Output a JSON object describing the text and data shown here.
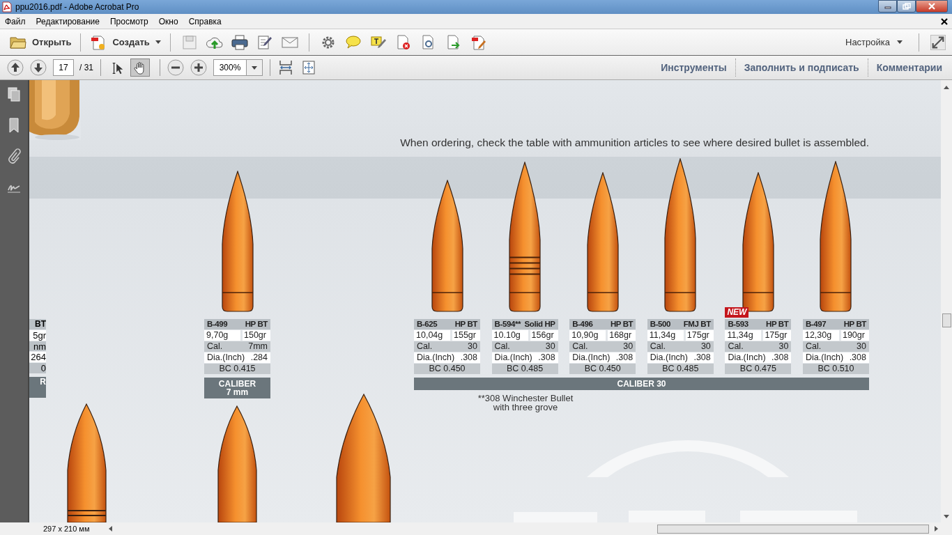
{
  "window": {
    "title": "ppu2016.pdf - Adobe Acrobat Pro"
  },
  "menu": [
    "Файл",
    "Редактирование",
    "Просмотр",
    "Окно",
    "Справка"
  ],
  "toolbar": {
    "open": "Открыть",
    "create": "Создать",
    "customize": "Настройка"
  },
  "navigation": {
    "page": "17",
    "total": "/ 31",
    "zoom": "300%",
    "tools": [
      {
        "kind": "select",
        "selected": false
      },
      {
        "kind": "hand",
        "selected": true
      }
    ]
  },
  "panels": [
    "Инструменты",
    "Заполнить и подписать",
    "Комментарии"
  ],
  "document": {
    "note": "When ordering, check the table with ammunition articles to see where desired bullet is assembled.",
    "cut_card": {
      "rows": [
        "BT",
        "5gr",
        "nm",
        "264",
        "0"
      ],
      "caliber": "R"
    },
    "groups": [
      {
        "caliber": [
          "CALIBER",
          "7 mm"
        ],
        "items": [
          {
            "code": "B-499",
            "type": "HP BT",
            "grams": "9,70g",
            "grains": "150gr",
            "cal_label": "Cal.",
            "cal": "7mm",
            "dia_label": "Dia.(Inch)",
            "dia": ".284",
            "bc": "BC 0.415",
            "grooved": false
          }
        ]
      },
      {
        "caliber": [
          "CALIBER 30"
        ],
        "footnote": [
          "**308 Winchester Bullet",
          "with three grove"
        ],
        "items": [
          {
            "code": "B-625",
            "type": "HP BT",
            "grams": "10,04g",
            "grains": "155gr",
            "cal_label": "Cal.",
            "cal": "30",
            "dia_label": "Dia.(Inch)",
            "dia": ".308",
            "bc": "BC 0.450",
            "grooved": false
          },
          {
            "code": "B-594**",
            "type": "Solid HP",
            "grams": "10.10g",
            "grains": "156gr",
            "cal_label": "Cal.",
            "cal": "30",
            "dia_label": "Dia.(Inch)",
            "dia": ".308",
            "bc": "BC 0.485",
            "grooved": true
          },
          {
            "code": "B-496",
            "type": "HP BT",
            "grams": "10,90g",
            "grains": "168gr",
            "cal_label": "Cal.",
            "cal": "30",
            "dia_label": "Dia.(Inch)",
            "dia": ".308",
            "bc": "BC 0.450",
            "grooved": false
          },
          {
            "code": "B-500",
            "type": "FMJ BT",
            "grams": "11,34g",
            "grains": "175gr",
            "cal_label": "Cal.",
            "cal": "30",
            "dia_label": "Dia.(Inch)",
            "dia": ".308",
            "bc": "BC 0.485",
            "grooved": false
          },
          {
            "code": "B-593",
            "type": "HP BT",
            "grams": "11,34g",
            "grains": "175gr",
            "cal_label": "Cal.",
            "cal": "30",
            "dia_label": "Dia.(Inch)",
            "dia": ".308",
            "bc": "BC 0.475",
            "grooved": false,
            "badge": "NEW"
          },
          {
            "code": "B-497",
            "type": "HP BT",
            "grams": "12,30g",
            "grains": "190gr",
            "cal_label": "Cal.",
            "cal": "30",
            "dia_label": "Dia.(Inch)",
            "dia": ".308",
            "bc": "BC 0.510",
            "grooved": false
          }
        ]
      }
    ]
  },
  "status_bar": {
    "page_size": "297 x 210 мм"
  }
}
